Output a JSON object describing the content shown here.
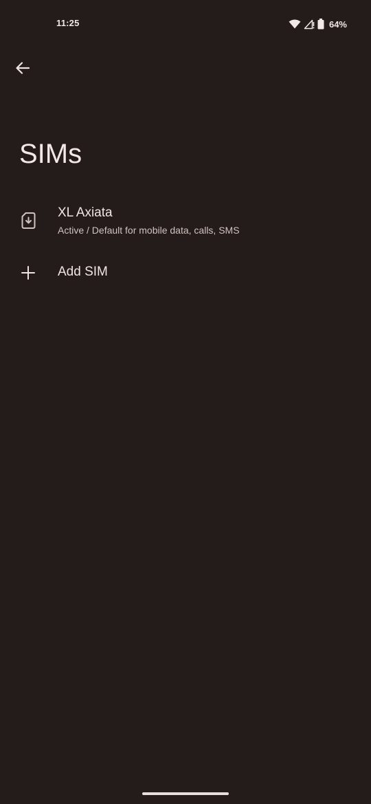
{
  "status_bar": {
    "time": "11:25",
    "battery_percent": "64%",
    "icons": [
      "wifi-icon",
      "cell-signal-icon",
      "battery-icon"
    ]
  },
  "header": {
    "back_icon": "arrow-back-icon",
    "title": "SIMs"
  },
  "sims": [
    {
      "name": "XL Axiata",
      "summary": "Active / Default for mobile data, calls, SMS",
      "icon": "esim-download-icon"
    }
  ],
  "add_sim": {
    "label": "Add SIM",
    "icon": "plus-icon"
  },
  "colors": {
    "background": "#231c1a",
    "primary_text": "#f1e5e2",
    "secondary_text": "#d2c3bf"
  }
}
